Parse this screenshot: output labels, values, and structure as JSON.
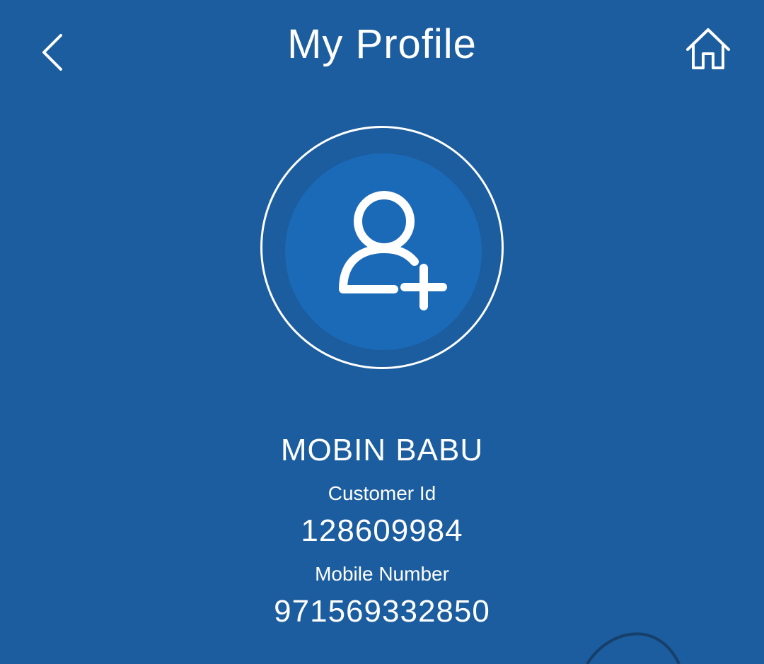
{
  "header": {
    "title": "My Profile",
    "back_icon": "chevron-left-icon",
    "home_icon": "home-icon"
  },
  "avatar": {
    "icon": "add-user-icon"
  },
  "profile": {
    "name": "MOBIN BABU",
    "customer_id_label": "Customer Id",
    "customer_id": "128609984",
    "mobile_label": "Mobile Number",
    "mobile": "971569332850"
  },
  "colors": {
    "background": "#1b5d9e",
    "avatar_fill": "#1b6ab8",
    "foreground": "#ffffff"
  }
}
